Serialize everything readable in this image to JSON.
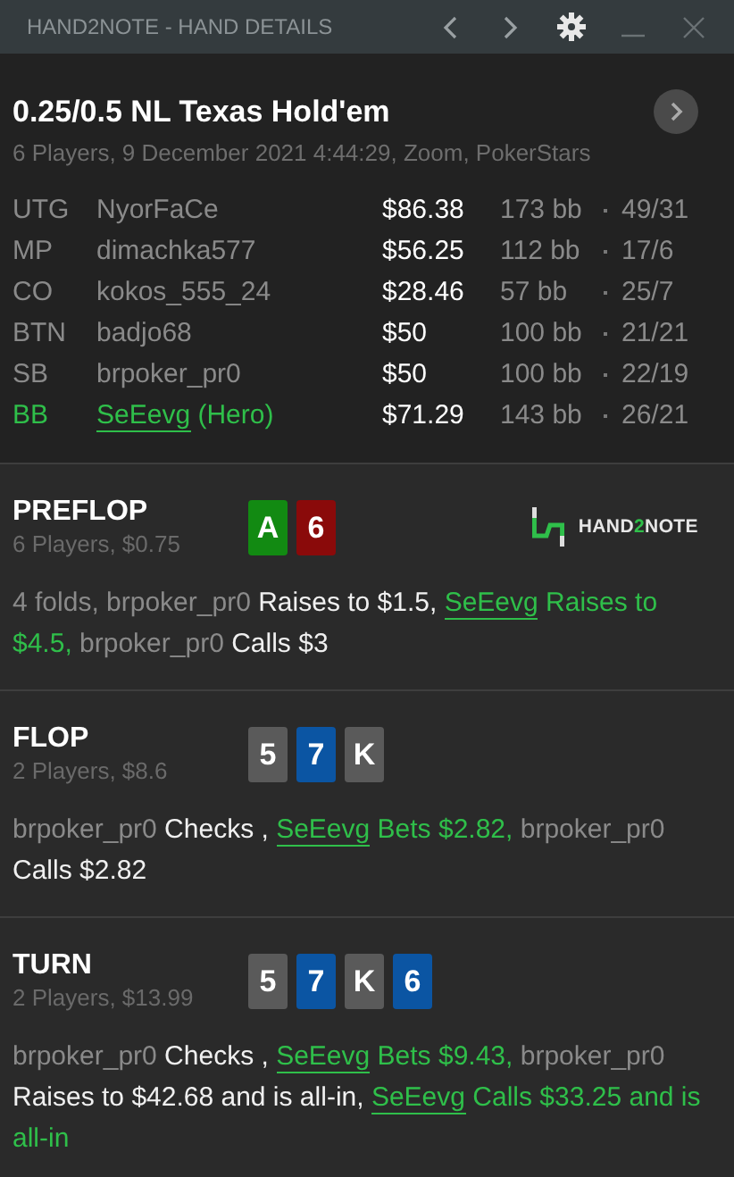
{
  "window": {
    "title": "HAND2NOTE - HAND DETAILS"
  },
  "hand": {
    "title": "0.25/0.5 NL Texas Hold'em",
    "subtitle": "6 Players, 9 December 2021 4:44:29, Zoom, PokerStars"
  },
  "players": [
    {
      "position": "UTG",
      "name": "NyorFaCe",
      "hero": false,
      "stack": "$86.38",
      "bb": "173 bb",
      "stat": "49/31"
    },
    {
      "position": "MP",
      "name": "dimachka577",
      "hero": false,
      "stack": "$56.25",
      "bb": "112 bb",
      "stat": "17/6"
    },
    {
      "position": "CO",
      "name": "kokos_555_24",
      "hero": false,
      "stack": "$28.46",
      "bb": "57 bb",
      "stat": "25/7"
    },
    {
      "position": "BTN",
      "name": "badjo68",
      "hero": false,
      "stack": "$50",
      "bb": "100 bb",
      "stat": "21/21"
    },
    {
      "position": "SB",
      "name": "brpoker_pr0",
      "hero": false,
      "stack": "$50",
      "bb": "100 bb",
      "stat": "22/19"
    },
    {
      "position": "BB",
      "name": "SeEevg",
      "hero": true,
      "hero_tag": "(Hero)",
      "stack": "$71.29",
      "bb": "143 bb",
      "stat": "26/21"
    }
  ],
  "logo": {
    "before": "HAND",
    "accent": "2",
    "after": "NOTE"
  },
  "streets": [
    {
      "name": "PREFLOP",
      "info": "6 Players, $0.75",
      "cards": [
        {
          "rank": "A",
          "color": "#128a12"
        },
        {
          "rank": "6",
          "color": "#8a0a0a"
        }
      ],
      "logo": true,
      "actions": [
        {
          "kind": "name",
          "text": "4 folds, brpoker_pr0"
        },
        {
          "kind": "action",
          "text": " Raises to $1.5, "
        },
        {
          "kind": "hero_link",
          "text": "SeEevg"
        },
        {
          "kind": "hero",
          "text": " Raises to $4.5, "
        },
        {
          "kind": "name",
          "text": "brpoker_pr0"
        },
        {
          "kind": "action",
          "text": " Calls $3"
        }
      ]
    },
    {
      "name": "FLOP",
      "info": "2 Players, $8.6",
      "cards": [
        {
          "rank": "5",
          "color": "#5a5a5a"
        },
        {
          "rank": "7",
          "color": "#0b55a3"
        },
        {
          "rank": "K",
          "color": "#5a5a5a"
        }
      ],
      "logo": false,
      "actions": [
        {
          "kind": "name",
          "text": "brpoker_pr0"
        },
        {
          "kind": "action",
          "text": " Checks , "
        },
        {
          "kind": "hero_link",
          "text": "SeEevg"
        },
        {
          "kind": "hero",
          "text": " Bets $2.82, "
        },
        {
          "kind": "name",
          "text": "brpoker_pr0"
        },
        {
          "kind": "action",
          "text": " Calls $2.82"
        }
      ]
    },
    {
      "name": "TURN",
      "info": "2 Players, $13.99",
      "cards": [
        {
          "rank": "5",
          "color": "#5a5a5a"
        },
        {
          "rank": "7",
          "color": "#0b55a3"
        },
        {
          "rank": "K",
          "color": "#5a5a5a"
        },
        {
          "rank": "6",
          "color": "#0b55a3"
        }
      ],
      "logo": false,
      "actions": [
        {
          "kind": "name",
          "text": "brpoker_pr0"
        },
        {
          "kind": "action",
          "text": " Checks , "
        },
        {
          "kind": "hero_link",
          "text": "SeEevg"
        },
        {
          "kind": "hero",
          "text": " Bets $9.43, "
        },
        {
          "kind": "name",
          "text": "brpoker_pr0"
        },
        {
          "kind": "action",
          "text": " Raises to $42.68 and is all-in, "
        },
        {
          "kind": "hero_link",
          "text": "SeEevg"
        },
        {
          "kind": "hero",
          "text": " Calls $33.25 and is all-in"
        }
      ]
    }
  ]
}
